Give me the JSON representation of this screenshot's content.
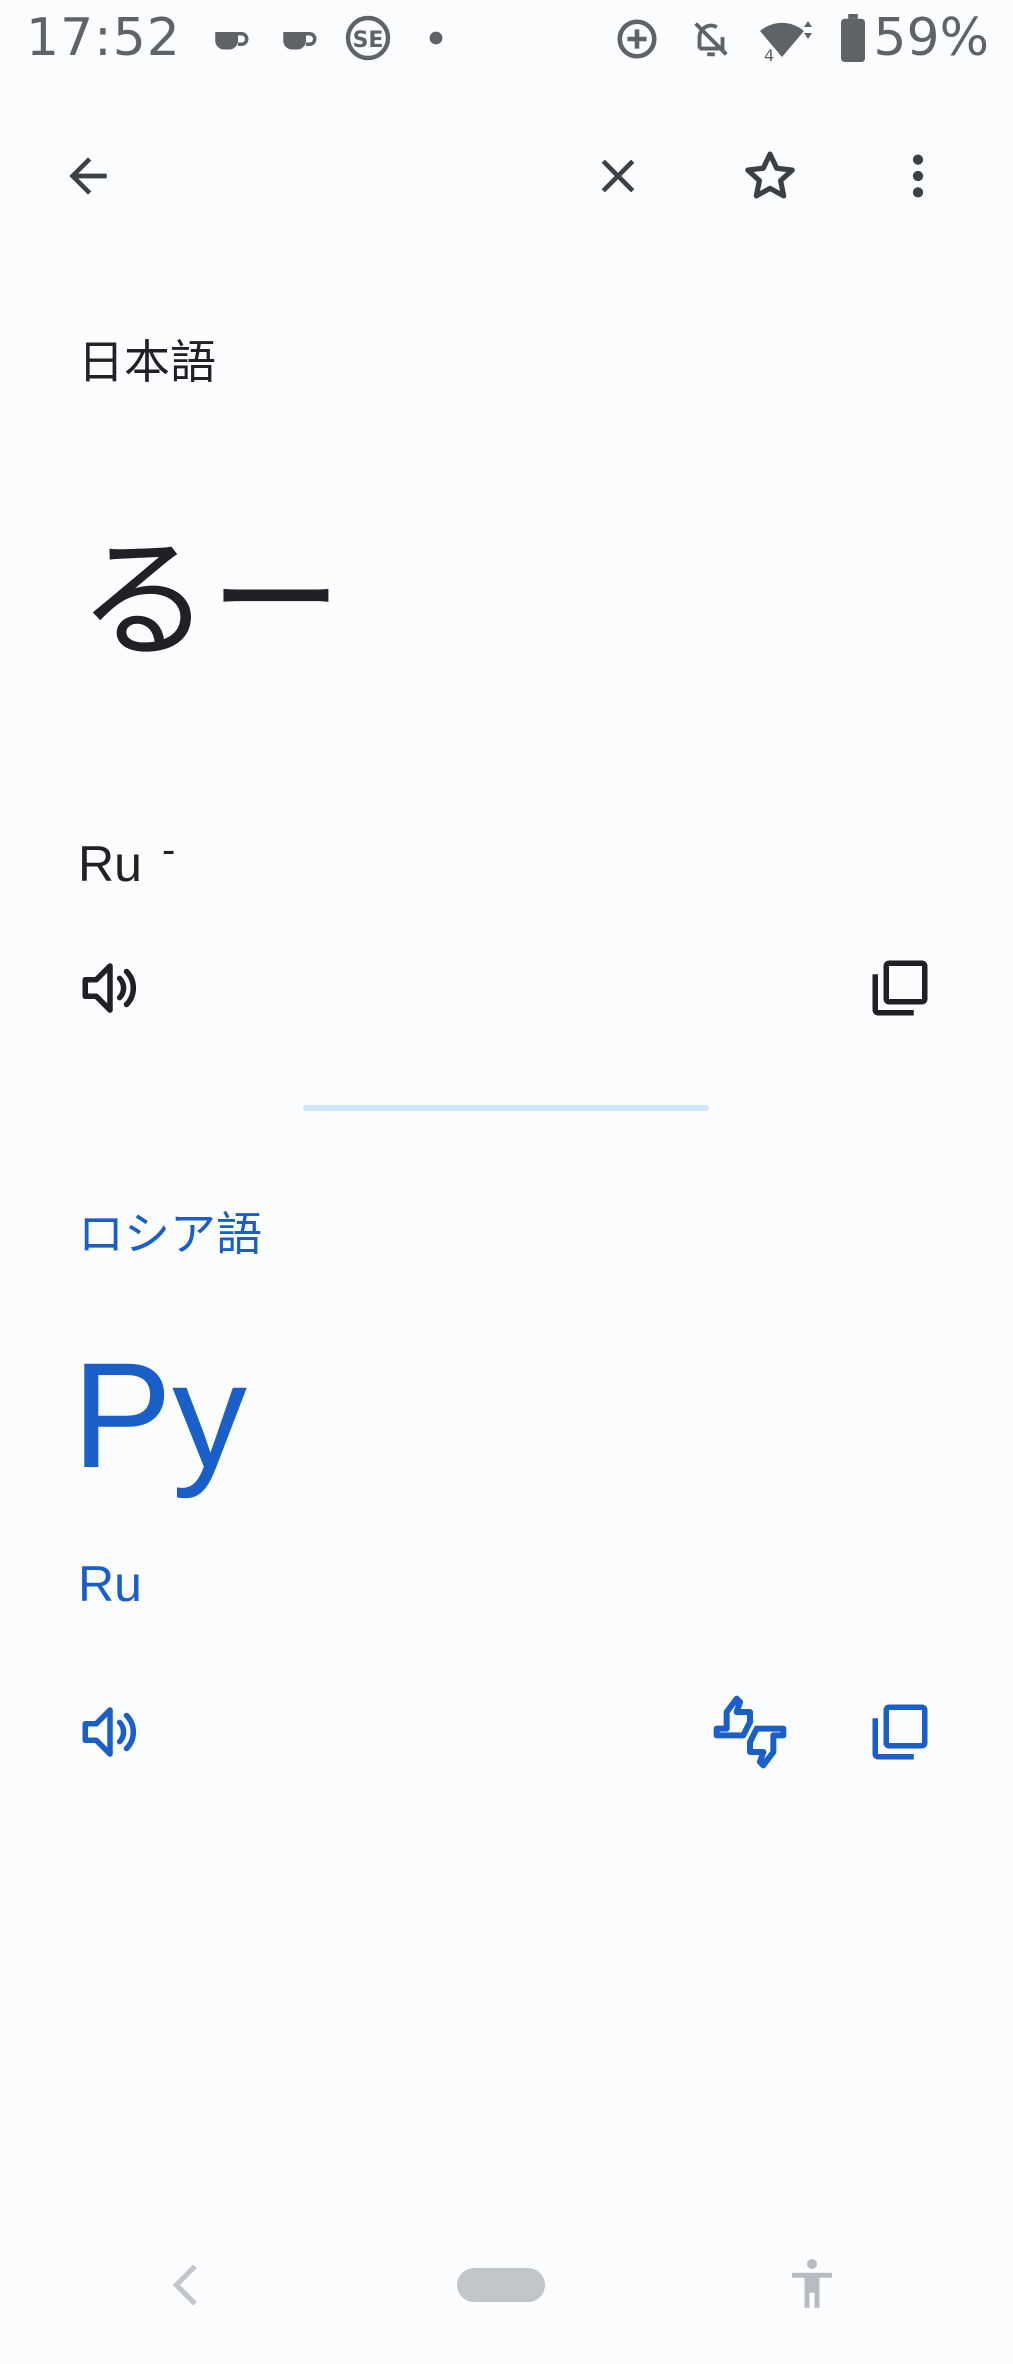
{
  "status_bar": {
    "time": "17:52",
    "battery_percent": "59%",
    "icons": [
      "coffee-icon",
      "coffee-icon",
      "se-app-icon",
      "dot-icon",
      "data-saver-icon",
      "notifications-off-icon",
      "wifi-icon",
      "battery-icon"
    ]
  },
  "toolbar": {
    "back_icon": "arrow-back-icon",
    "clear_icon": "close-icon",
    "star_icon": "star-outline-icon",
    "more_icon": "more-vert-icon"
  },
  "source": {
    "language": "日本語",
    "text": "るー",
    "transliteration": "Ru",
    "transliteration_mark": "-"
  },
  "target": {
    "language": "ロシア語",
    "text": "Ру",
    "transliteration": "Ru"
  },
  "colors": {
    "accent": "#1a5fc7",
    "text": "#202124",
    "icon_gray": "#5f6368",
    "divider": "#cfe5f8",
    "background": "#fbfcfe"
  }
}
